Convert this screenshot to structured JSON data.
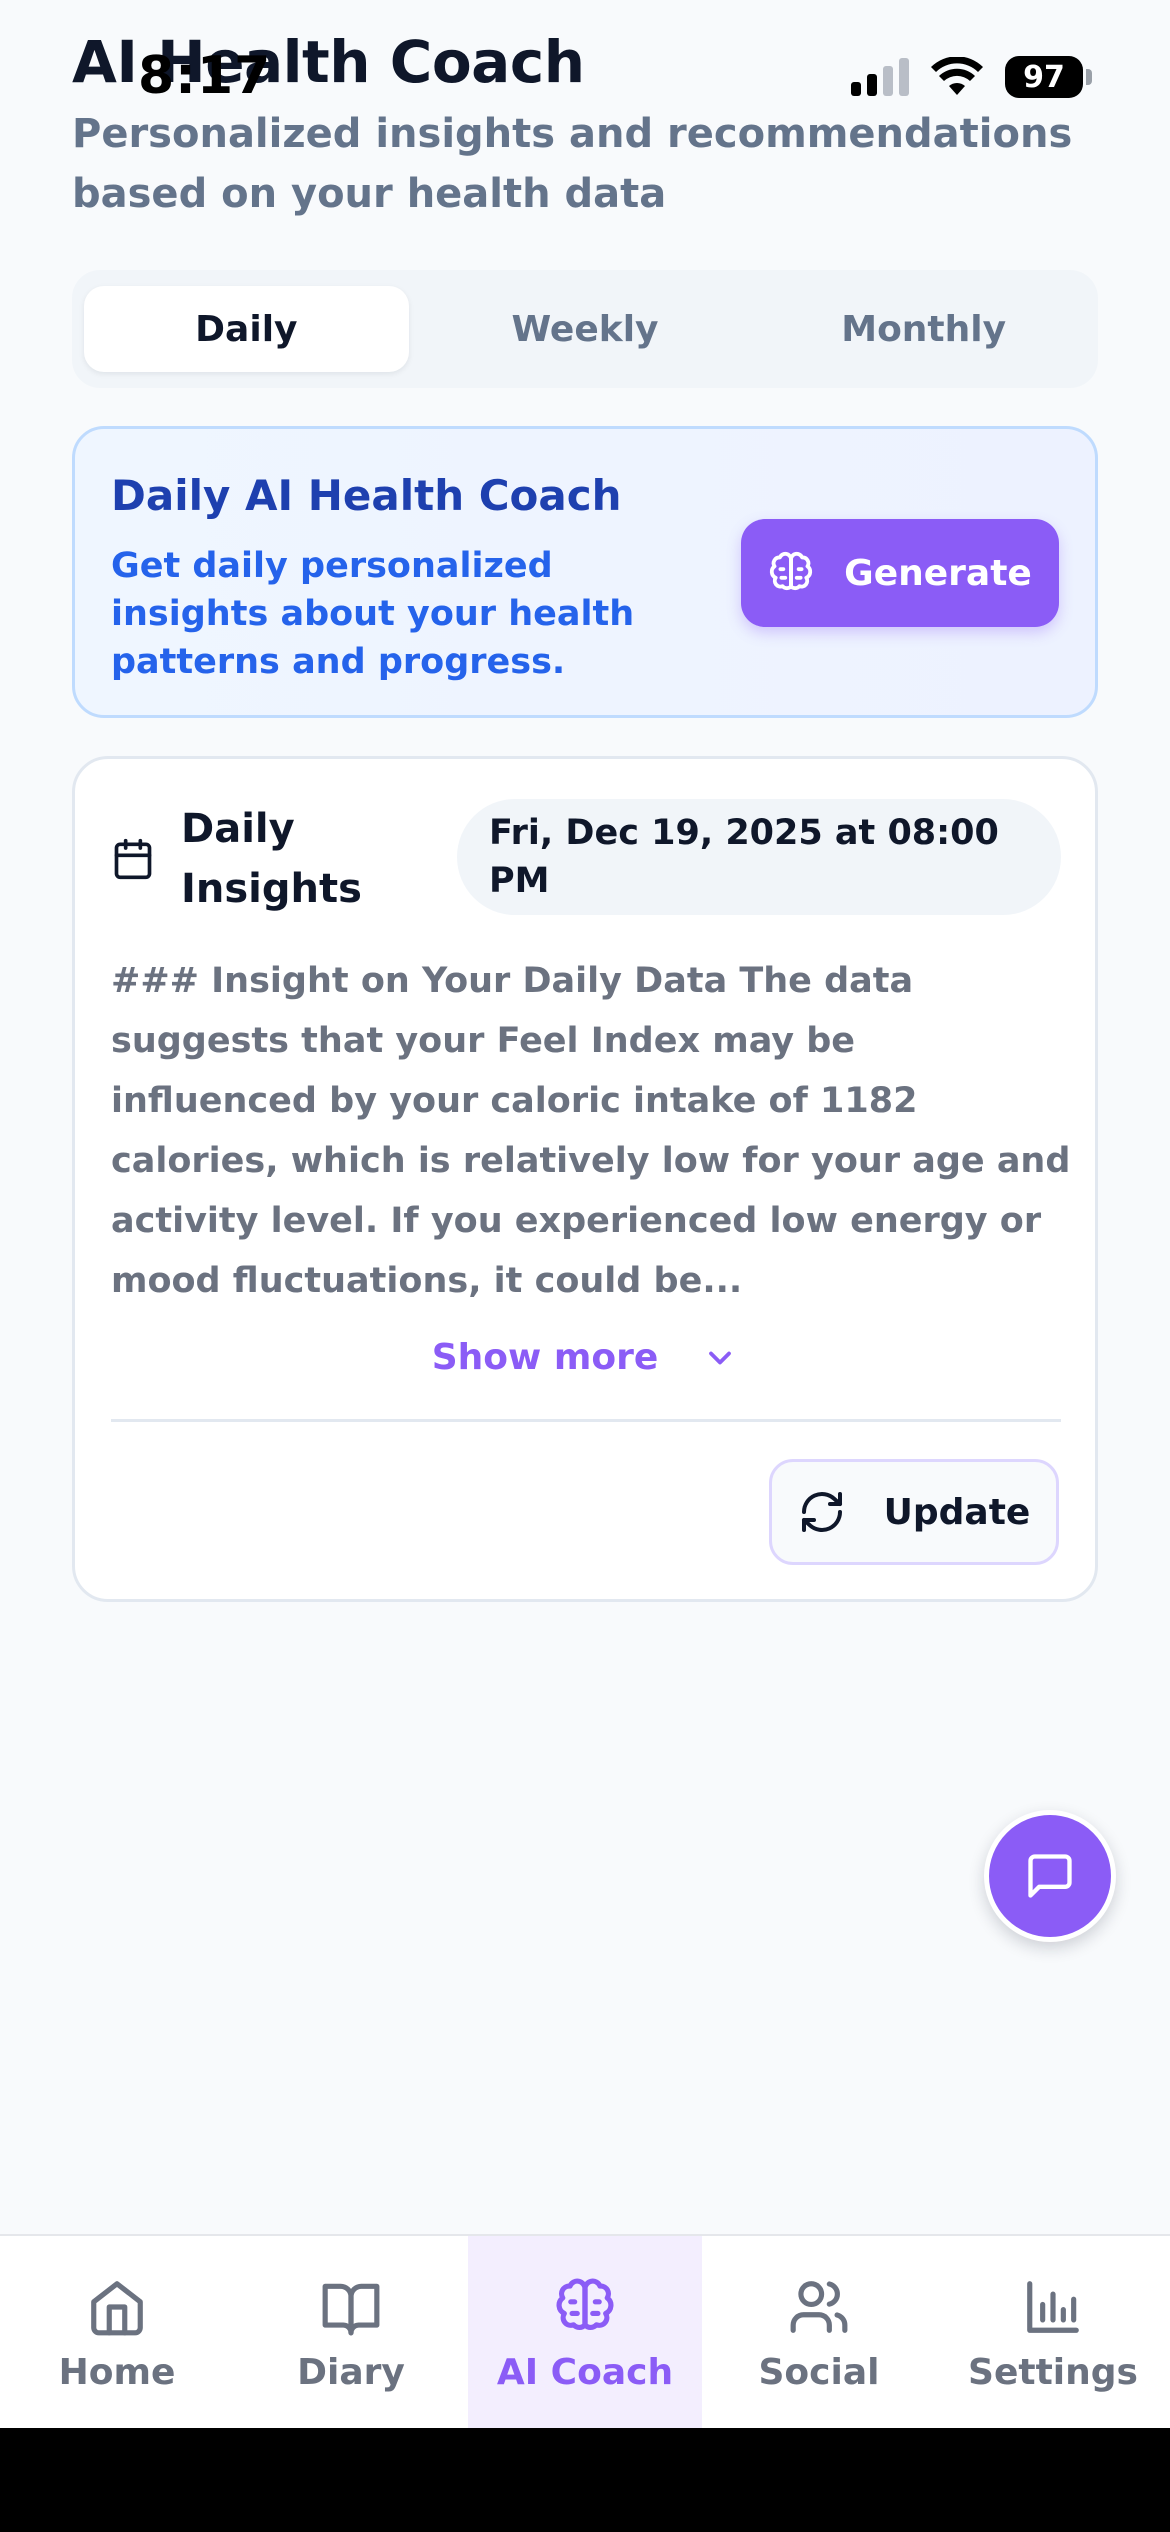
{
  "status_bar": {
    "time": "8:17",
    "battery": "97"
  },
  "header": {
    "title": "AI Health Coach",
    "subtitle": "Personalized insights and recommendations based on your health data"
  },
  "tabs": [
    {
      "label": "Daily",
      "active": true
    },
    {
      "label": "Weekly",
      "active": false
    },
    {
      "label": "Monthly",
      "active": false
    }
  ],
  "promo": {
    "title": "Daily AI Health Coach",
    "text": "Get daily personalized insights about your health patterns and progress.",
    "button_label": "Generate"
  },
  "insights": {
    "title": "Daily Insights",
    "date": "Fri, Dec 19, 2025 at 08:00 PM",
    "body": "### Insight on Your Daily Data The data suggests that your Feel Index may be influenced by your caloric intake of 1182 calories, which is relatively low for your age and activity level. If you experienced low energy or mood fluctuations, it could be...",
    "show_more_label": "Show more",
    "update_label": "Update"
  },
  "nav": [
    {
      "label": "Home",
      "icon": "home-icon",
      "active": false
    },
    {
      "label": "Diary",
      "icon": "book-icon",
      "active": false
    },
    {
      "label": "AI Coach",
      "icon": "brain-icon",
      "active": true
    },
    {
      "label": "Social",
      "icon": "users-icon",
      "active": false
    },
    {
      "label": "Settings",
      "icon": "bar-chart-icon",
      "active": false
    }
  ],
  "colors": {
    "accent": "#8b5cf6",
    "promo_title": "#1e40af",
    "promo_text": "#2563eb",
    "muted_text": "#64748b"
  }
}
